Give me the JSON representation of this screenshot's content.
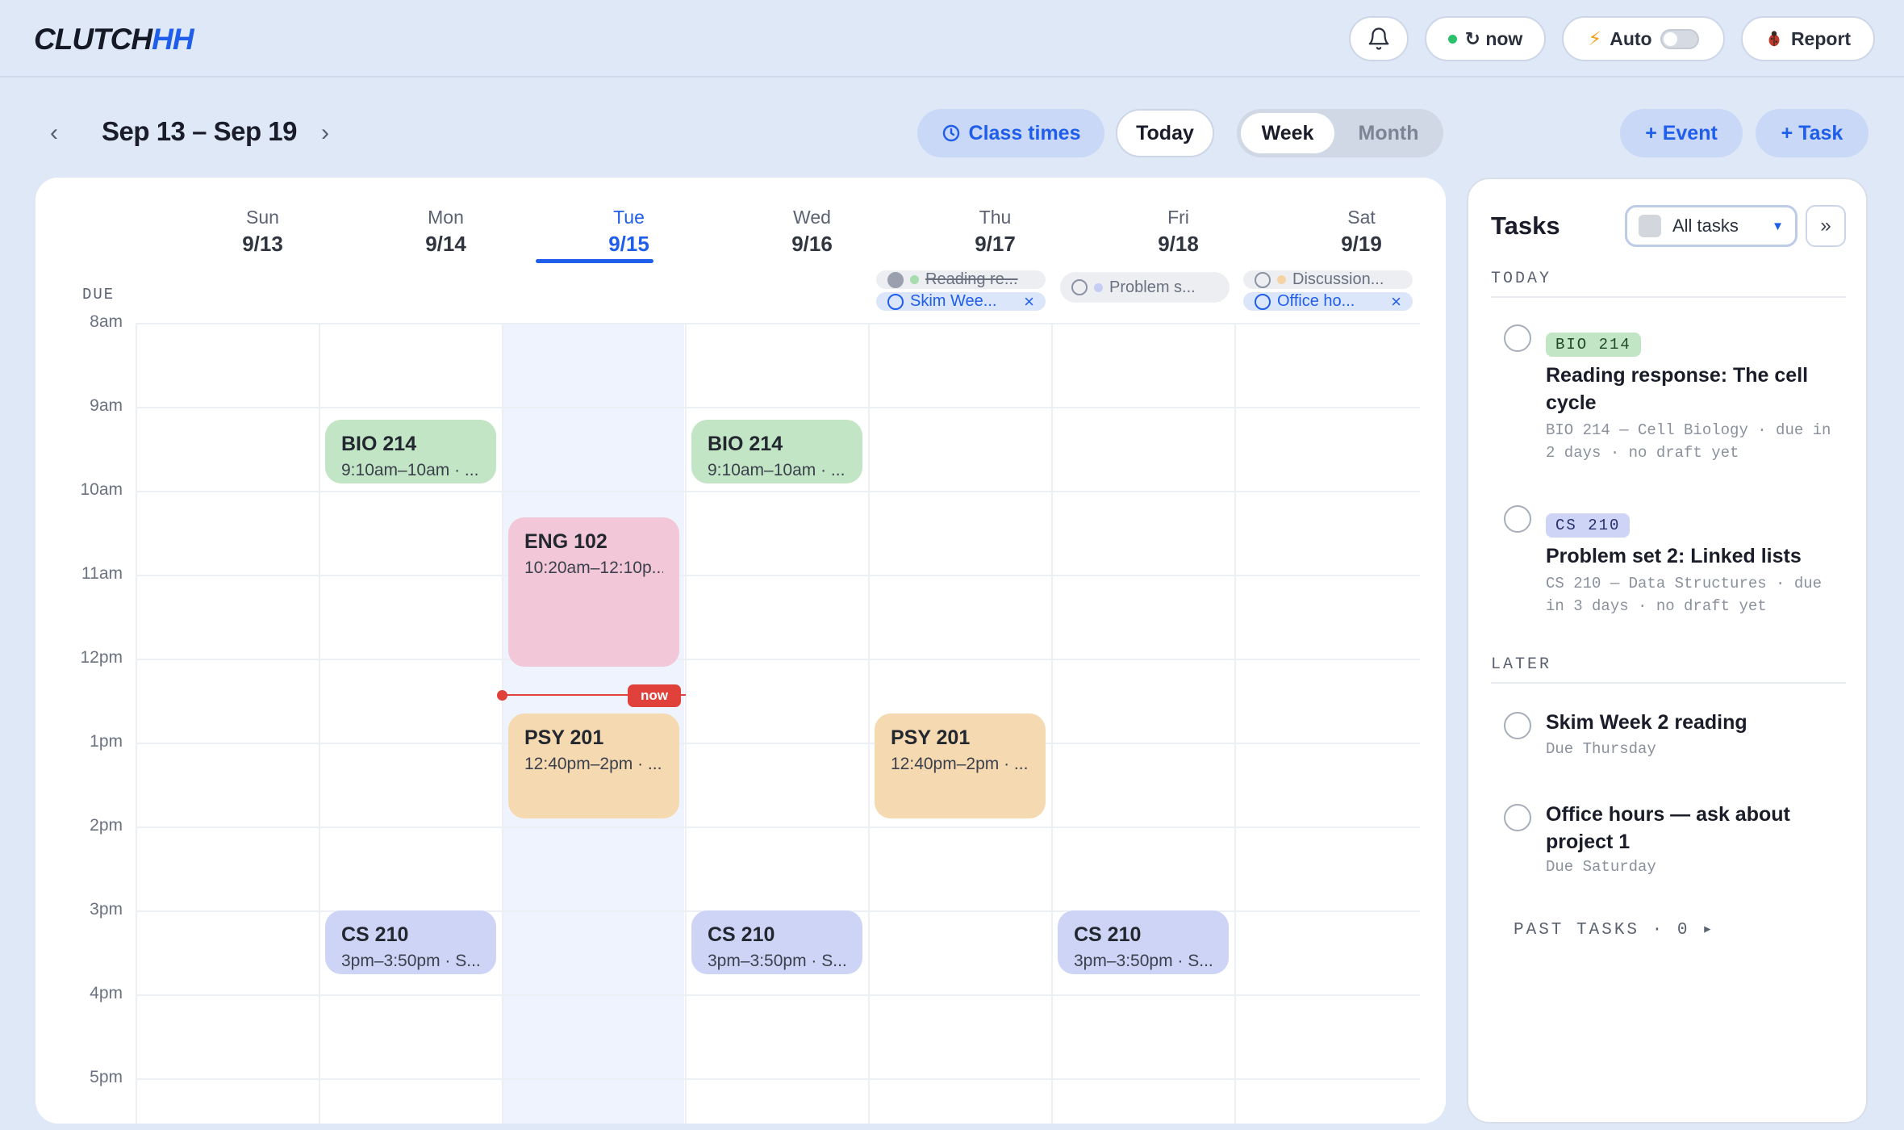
{
  "app": {
    "logo_main": "CLUTCH",
    "logo_accent": "H"
  },
  "topbar": {
    "bell_icon": "bell-icon",
    "status_text": "↻ now",
    "auto_label": "Auto",
    "auto_enabled": false,
    "report_label": "Report",
    "report_icon": "bug-icon"
  },
  "nav": {
    "prev": "‹",
    "next": "›",
    "range": "Sep 13 – Sep 19",
    "class_times": "Class times",
    "today": "Today",
    "views": [
      "Week",
      "Month"
    ],
    "active_view": "Week",
    "add_event": "+ Event",
    "add_task": "+ Task"
  },
  "colors": {
    "accent": "#1f5eea",
    "now": "#e0413b",
    "bio": "#c2e5c5",
    "eng": "#f2c8d8",
    "psy": "#f5d9b1",
    "cs": "#cdd4f6"
  },
  "days": [
    {
      "name": "Sun",
      "date": "9/13"
    },
    {
      "name": "Mon",
      "date": "9/14"
    },
    {
      "name": "Tue",
      "date": "9/15",
      "today": true
    },
    {
      "name": "Wed",
      "date": "9/16"
    },
    {
      "name": "Thu",
      "date": "9/17"
    },
    {
      "name": "Fri",
      "date": "9/18"
    },
    {
      "name": "Sat",
      "date": "9/19"
    }
  ],
  "due_label": "DUE",
  "due_chips": {
    "thu_1": "Reading re...",
    "thu_2": "Skim Wee...",
    "fri_1": "Problem s...",
    "sat_1": "Discussion...",
    "sat_2": "Office ho..."
  },
  "hours": [
    "8am",
    "9am",
    "10am",
    "11am",
    "12pm",
    "1pm",
    "2pm",
    "3pm",
    "4pm",
    "5pm"
  ],
  "events": {
    "bio_mon": {
      "title": "BIO 214",
      "sub": "9:10am–10am · ..."
    },
    "bio_wed": {
      "title": "BIO 214",
      "sub": "9:10am–10am · ..."
    },
    "eng_tue": {
      "title": "ENG 102",
      "sub": "10:20am–12:10p..."
    },
    "psy_tue": {
      "title": "PSY 201",
      "sub": "12:40pm–2pm · ..."
    },
    "psy_thu": {
      "title": "PSY 201",
      "sub": "12:40pm–2pm · ..."
    },
    "cs_mon": {
      "title": "CS 210",
      "sub": "3pm–3:50pm · S..."
    },
    "cs_wed": {
      "title": "CS 210",
      "sub": "3pm–3:50pm · S..."
    },
    "cs_fri": {
      "title": "CS 210",
      "sub": "3pm–3:50pm · S..."
    }
  },
  "now_badge": "now",
  "tasks": {
    "title": "Tasks",
    "filter": "All tasks",
    "collapse": "»",
    "today_header": "TODAY",
    "later_header": "LATER",
    "t1": {
      "tag": "BIO 214",
      "title": "Reading response: The cell cycle",
      "meta": "BIO 214 — Cell Biology · due in 2 days · no draft yet"
    },
    "t2": {
      "tag": "CS 210",
      "title": "Problem set 2: Linked lists",
      "meta": "CS 210 — Data Structures · due in 3 days · no draft yet"
    },
    "t3": {
      "title": "Skim Week 2 reading",
      "meta": "Due Thursday"
    },
    "t4": {
      "title": "Office hours — ask about project 1",
      "meta": "Due Saturday"
    },
    "past": "PAST TASKS · 0 ▸"
  }
}
